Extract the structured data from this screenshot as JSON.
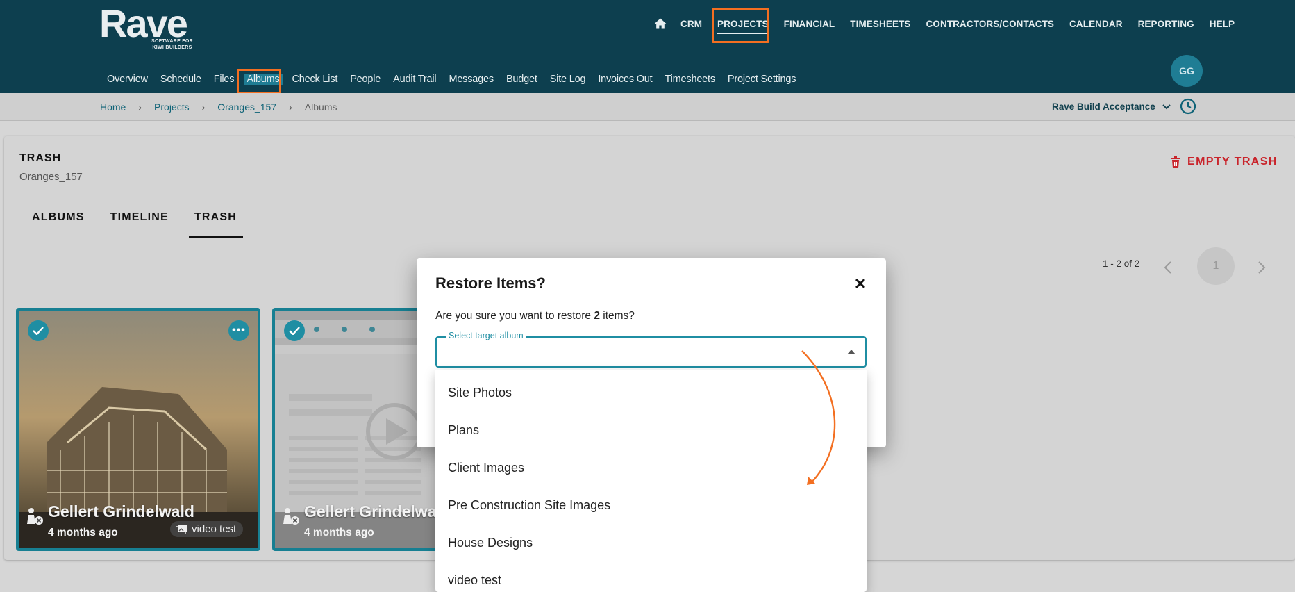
{
  "brand": {
    "name": "Rave",
    "tagline_line1": "SOFTWARE FOR",
    "tagline_line2": "KIWI BUILDERS"
  },
  "main_nav": {
    "items": [
      "CRM",
      "PROJECTS",
      "FINANCIAL",
      "TIMESHEETS",
      "CONTRACTORS/CONTACTS",
      "CALENDAR",
      "REPORTING",
      "HELP"
    ],
    "active": "PROJECTS"
  },
  "sub_nav": {
    "items": [
      "Overview",
      "Schedule",
      "Files",
      "Albums",
      "Check List",
      "People",
      "Audit Trail",
      "Messages",
      "Budget",
      "Site Log",
      "Invoices Out",
      "Timesheets",
      "Project Settings"
    ],
    "active": "Albums"
  },
  "user": {
    "initials": "GG"
  },
  "breadcrumb": [
    "Home",
    "Projects",
    "Oranges_157",
    "Albums"
  ],
  "company": "Rave Build Acceptance",
  "page": {
    "title": "TRASH",
    "subtitle": "Oranges_157",
    "empty_trash_label": "EMPTY TRASH"
  },
  "tabs": [
    "ALBUMS",
    "TIMELINE",
    "TRASH"
  ],
  "active_tab": "TRASH",
  "pagination": {
    "range": "1 - 2 of 2",
    "page": "1"
  },
  "tiles": [
    {
      "name": "Gellert Grindelwald",
      "ago": "4 months ago",
      "album": "video test"
    },
    {
      "name": "Gellert Grindelwald",
      "ago": "4 months ago"
    }
  ],
  "modal": {
    "title": "Restore Items?",
    "message_prefix": "Are you sure you want to restore",
    "count": "2",
    "message_suffix": "items?",
    "select_label": "Select target album",
    "options": [
      "Site Photos",
      "Plans",
      "Client Images",
      "Pre Construction Site Images",
      "House Designs",
      "video test"
    ]
  },
  "colors": {
    "header_bg": "#0d3f4f",
    "accent": "#1f8ea3",
    "highlight": "#f36f21",
    "danger": "#c9242b"
  }
}
